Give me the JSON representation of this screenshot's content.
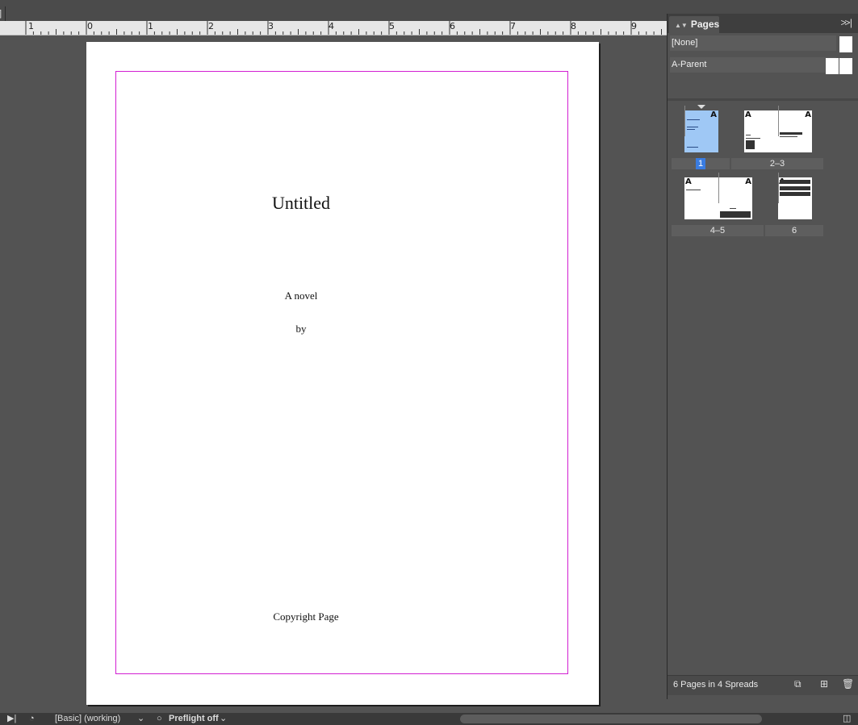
{
  "document_tab": {
    "label": "]"
  },
  "ruler": {
    "labels": [
      "1",
      "0",
      "1",
      "2",
      "3",
      "4",
      "5",
      "6",
      "7",
      "8",
      "9"
    ]
  },
  "page": {
    "title": "Untitled",
    "subtitle": "A novel",
    "byline": "by",
    "footer": "Copyright Page"
  },
  "pages_panel": {
    "tab_label": "Pages",
    "collapse_icon": "double-chevron-right-icon",
    "parents": [
      {
        "label": "[None]"
      },
      {
        "label": "A-Parent"
      }
    ],
    "spreads": [
      {
        "label": "1",
        "selected": true
      },
      {
        "label": "2–3",
        "selected": false
      },
      {
        "label": "4–5",
        "selected": false
      },
      {
        "label": "6",
        "selected": false
      }
    ],
    "parent_marker": "A",
    "footer_text": "6 Pages in 4 Spreads",
    "footer_icons": [
      "page-size-icon",
      "new-page-icon",
      "trash-icon"
    ]
  },
  "status_bar": {
    "workspace": "[Basic] (working)",
    "preflight": "Preflight off"
  },
  "colors": {
    "accent": "#3a7ce0",
    "margin_guide": "#d21fd2",
    "selected_thumb": "#9fc8f5",
    "ui_background": "#535353"
  }
}
